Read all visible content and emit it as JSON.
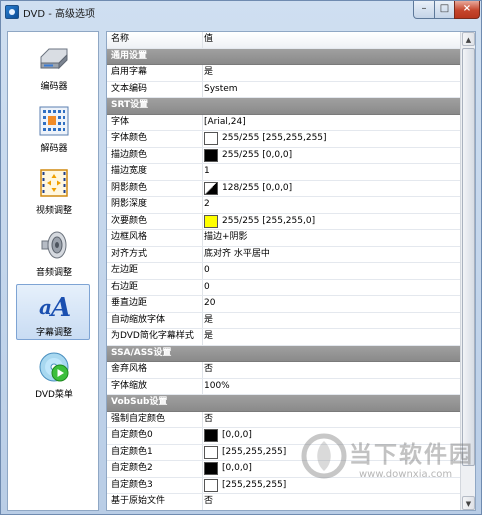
{
  "window": {
    "title": "DVD - 高级选项",
    "buttons": {
      "minimize": "–",
      "maximize": "□",
      "close": "×"
    }
  },
  "sidebar": {
    "items": [
      {
        "label": "编码器",
        "icon": "encoder-drive-icon",
        "active": false
      },
      {
        "label": "解码器",
        "icon": "decoder-chip-icon",
        "active": false
      },
      {
        "label": "视频调整",
        "icon": "video-adjust-icon",
        "active": false
      },
      {
        "label": "音频调整",
        "icon": "speaker-icon",
        "active": false
      },
      {
        "label": "字幕调整",
        "icon": "subtitle-font-icon",
        "active": true
      },
      {
        "label": "DVD菜单",
        "icon": "dvd-menu-disc-icon",
        "active": false
      }
    ]
  },
  "grid": {
    "header": {
      "name": "名称",
      "value": "值"
    },
    "general": {
      "title": "通用设置",
      "enable_subtitle": {
        "key": "启用字幕",
        "value": "是"
      },
      "text_encoding": {
        "key": "文本编码",
        "value": "System"
      }
    },
    "srt": {
      "title": "SRT设置",
      "font": {
        "key": "字体",
        "value": "[Arial,24]"
      },
      "font_color": {
        "key": "字体颜色",
        "value": "255/255 [255,255,255]",
        "color": "#ffffff"
      },
      "outline_color": {
        "key": "描边颜色",
        "value": "255/255 [0,0,0]",
        "color": "#000000"
      },
      "outline_width": {
        "key": "描边宽度",
        "value": "1"
      },
      "shadow_color": {
        "key": "阴影颜色",
        "value": "128/255 [0,0,0]",
        "color": "#000000"
      },
      "shadow_depth": {
        "key": "阴影深度",
        "value": "2"
      },
      "secondary_color": {
        "key": "次要颜色",
        "value": "255/255 [255,255,0]",
        "color": "#ffff00"
      },
      "border_style": {
        "key": "边框风格",
        "value": "描边+阴影"
      },
      "alignment": {
        "key": "对齐方式",
        "value": "底对齐 水平居中"
      },
      "left_margin": {
        "key": "左边距",
        "value": "0"
      },
      "right_margin": {
        "key": "右边距",
        "value": "0"
      },
      "vertical_margin": {
        "key": "垂直边距",
        "value": "20"
      },
      "auto_scale": {
        "key": "自动缩放字体",
        "value": "是"
      },
      "simplify_dvd": {
        "key": "为DVD简化字幕样式",
        "value": "是"
      }
    },
    "ssa": {
      "title": "SSA/ASS设置",
      "discard_style": {
        "key": "舍弃风格",
        "value": "否"
      },
      "font_scale": {
        "key": "字体缩放",
        "value": "100%"
      }
    },
    "vobsub": {
      "title": "VobSub设置",
      "force_custom": {
        "key": "强制自定颜色",
        "value": "否"
      },
      "color0": {
        "key": "自定颜色0",
        "value": "[0,0,0]",
        "color": "#000000"
      },
      "color1": {
        "key": "自定颜色1",
        "value": "[255,255,255]",
        "color": "#ffffff"
      },
      "color2": {
        "key": "自定颜色2",
        "value": "[0,0,0]",
        "color": "#000000"
      },
      "color3": {
        "key": "自定颜色3",
        "value": "[255,255,255]",
        "color": "#ffffff"
      },
      "based_on_source": {
        "key": "基于原始文件",
        "value": "否"
      }
    }
  },
  "watermark": {
    "title": "当下软件园",
    "url": "www.downxia.com"
  }
}
